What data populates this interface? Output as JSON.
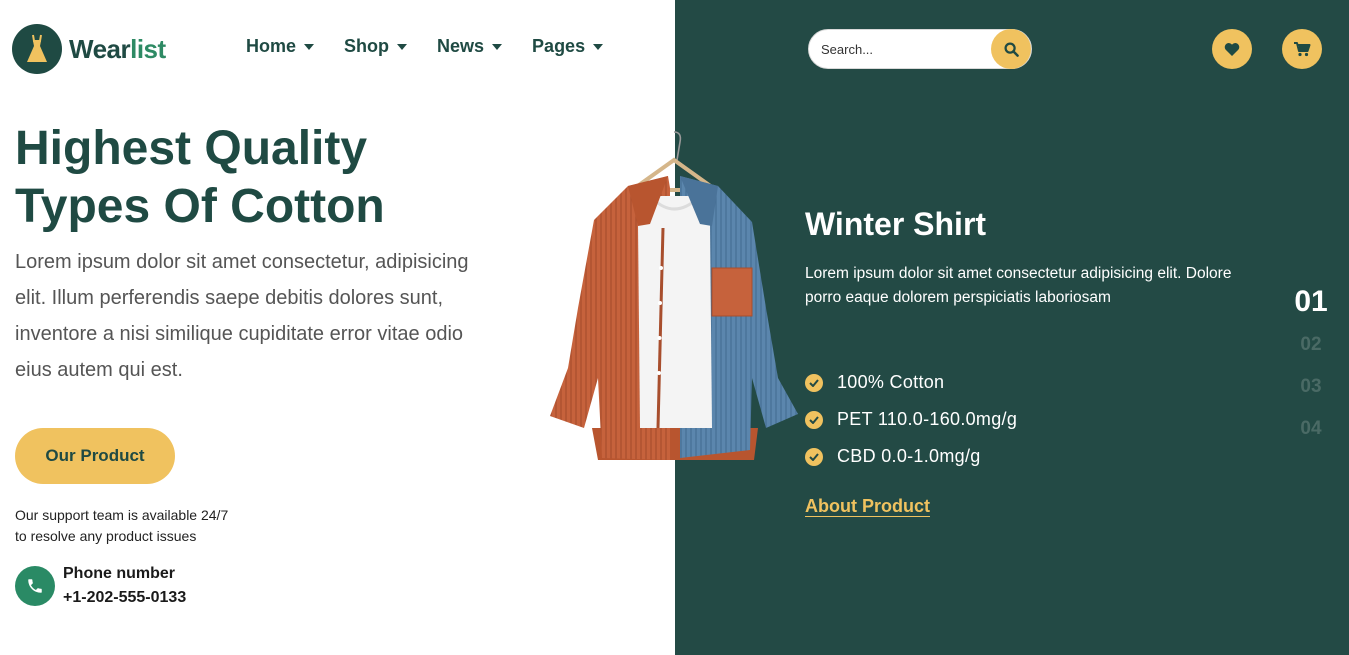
{
  "brand": {
    "name_part1": "Wear",
    "name_part2": "list"
  },
  "nav": {
    "items": [
      {
        "label": "Home"
      },
      {
        "label": "Shop"
      },
      {
        "label": "News"
      },
      {
        "label": "Pages"
      }
    ]
  },
  "search": {
    "placeholder": "Search..."
  },
  "hero": {
    "title_line1": "Highest Quality",
    "title_line2": "Types Of Cotton",
    "description": "Lorem ipsum dolor sit amet consectetur, adipisicing elit. Illum perferendis saepe debitis dolores sunt, inventore a nisi similique cupiditate error vitae odio eius autem qui est.",
    "button_label": "Our Product",
    "support_line1": "Our support team is available 24/7",
    "support_line2": "to resolve any product issues",
    "phone_label": "Phone number",
    "phone_number": "+1-202-555-0133"
  },
  "product": {
    "title": "Winter Shirt",
    "description": "Lorem ipsum dolor sit amet consectetur adipisicing elit. Dolore porro eaque dolorem perspiciatis laboriosam",
    "features": [
      "100% Cotton",
      "PET 110.0-160.0mg/g",
      "CBD 0.0-1.0mg/g"
    ],
    "link_label": "About Product"
  },
  "slides": {
    "active": "01",
    "others": [
      "02",
      "03",
      "04"
    ]
  },
  "colors": {
    "dark_green": "#234a45",
    "accent": "#f0c25f",
    "brand_green": "#2e8a64"
  }
}
